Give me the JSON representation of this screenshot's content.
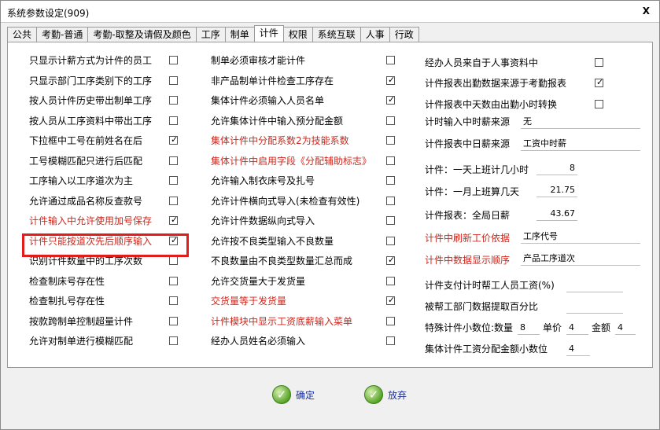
{
  "window": {
    "title": "系统参数设定(909)",
    "close_label": "X"
  },
  "tabs": [
    "公共",
    "考勤-普通",
    "考勤-取整及请假及颜色",
    "工序",
    "制单",
    "计件",
    "权限",
    "系统互联",
    "人事",
    "行政"
  ],
  "active_tab": "计件",
  "col1": [
    {
      "label": "只显示计薪方式为计件的员工",
      "checked": false,
      "red": false
    },
    {
      "label": "只显示部门工序类别下的工序",
      "checked": false,
      "red": false
    },
    {
      "label": "按人员计件历史带出制单工序",
      "checked": false,
      "red": false
    },
    {
      "label": "按人员从工序资料中带出工序",
      "checked": false,
      "red": false
    },
    {
      "label": "下拉框中工号在前姓名在后",
      "checked": true,
      "red": false
    },
    {
      "label": "工号模糊匹配只进行后匹配",
      "checked": false,
      "red": false
    },
    {
      "label": "工序输入以工序道次为主",
      "checked": false,
      "red": false
    },
    {
      "label": "允许通过成品名称反查款号",
      "checked": false,
      "red": false
    },
    {
      "label": "计件输入中允许使用加号保存",
      "checked": true,
      "red": true
    },
    {
      "label": "计件只能按道次先后顺序输入",
      "checked": true,
      "red": true
    },
    {
      "label": "识别计件数量中的工序次数",
      "checked": false,
      "red": false
    },
    {
      "label": "检查制床号存在性",
      "checked": false,
      "red": false
    },
    {
      "label": "检查制扎号存在性",
      "checked": false,
      "red": false
    },
    {
      "label": "按款跨制单控制超量计件",
      "checked": false,
      "red": false
    },
    {
      "label": "允许对制单进行模糊匹配",
      "checked": false,
      "red": false
    }
  ],
  "col2": [
    {
      "label": "制单必须审核才能计件",
      "checked": false,
      "red": false
    },
    {
      "label": "非产品制单计件检查工序存在",
      "checked": true,
      "red": false
    },
    {
      "label": "集体计件必须输入人员名单",
      "checked": true,
      "red": false
    },
    {
      "label": "允许集体计件中输入预分配金额",
      "checked": false,
      "red": false
    },
    {
      "label": "集体计件中分配系数2为技能系数",
      "checked": false,
      "red": true
    },
    {
      "label": "集体计件中启用字段《分配辅助标志》",
      "checked": false,
      "red": true
    },
    {
      "label": "允许输入制衣床号及扎号",
      "checked": false,
      "red": false
    },
    {
      "label": "允许计件横向式导入(未检查有效性)",
      "checked": false,
      "red": false
    },
    {
      "label": "允许计件数据纵向式导入",
      "checked": false,
      "red": false
    },
    {
      "label": "允许按不良类型输入不良数量",
      "checked": false,
      "red": false
    },
    {
      "label": "不良数量由不良类型数量汇总而成",
      "checked": true,
      "red": false
    },
    {
      "label": "允许交货量大于发货量",
      "checked": false,
      "red": false
    },
    {
      "label": "交货量等于发货量",
      "checked": true,
      "red": true
    },
    {
      "label": "计件模块中显示工资底薪输入菜单",
      "checked": false,
      "red": true
    },
    {
      "label": "经办人员姓名必须输入",
      "checked": false,
      "red": false
    }
  ],
  "col3_checks": [
    {
      "label": "经办人员来自于人事资料中",
      "checked": false
    },
    {
      "label": "计件报表出勤数据来源于考勤报表",
      "checked": true
    },
    {
      "label": "计件报表中天数由出勤小时转换",
      "checked": false
    }
  ],
  "col3_fields": {
    "time_source_label": "计时输入中时薪来源",
    "time_source_value": "无",
    "report_daily_label": "计件报表中日薪来源",
    "report_daily_value": "工资中时薪",
    "day_hours_label": "计件：一天上班计几小时",
    "day_hours_value": "8",
    "month_days_label": "计件：一月上班算几天",
    "month_days_value": "21.75",
    "report_daily_salary_label": "计件报表：全局日薪",
    "report_daily_salary_value": "43.67",
    "refresh_basis_label": "计件中刷新工价依据",
    "refresh_basis_value": "工序代号",
    "display_order_label": "计件中数据显示顺序",
    "display_order_value": "产品工序道次",
    "hourly_help_label": "计件支付计时帮工人员工资(%)",
    "hourly_help_value": "",
    "dept_pct_label": "被帮工部门数据提取百分比",
    "dept_pct_value": "",
    "decimals_label": "特殊计件小数位:数量",
    "decimals_qty": "8",
    "unit_price_label": "单价",
    "decimals_price": "4",
    "amount_label": "金额",
    "decimals_amount": "4",
    "group_decimals_label": "集体计件工资分配金额小数位",
    "group_decimals_value": "4"
  },
  "buttons": {
    "ok": "确定",
    "cancel": "放弃"
  },
  "colors": {
    "accent_red": "#d0261c",
    "highlight": "#e21b1b",
    "button_text": "#1a2f9c"
  }
}
